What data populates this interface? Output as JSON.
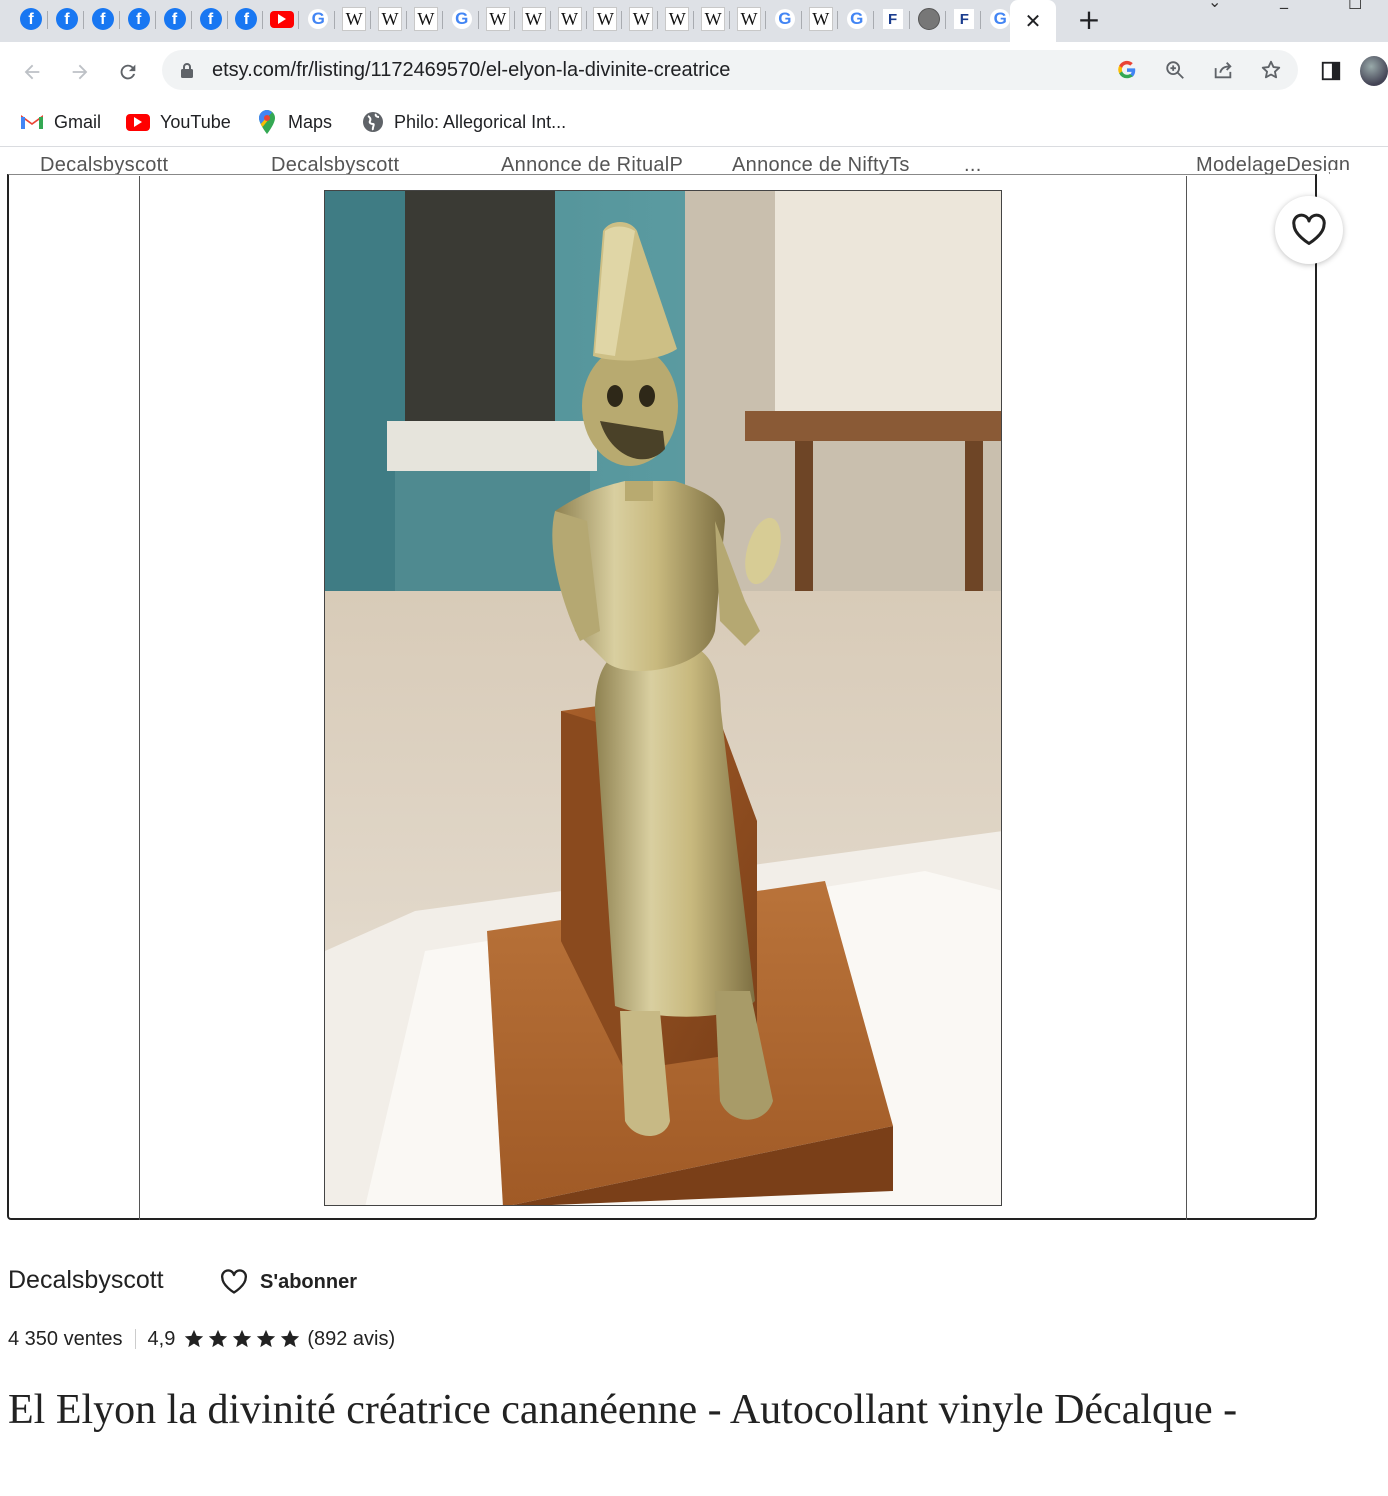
{
  "browser": {
    "tabs": [
      {
        "icon": "facebook-icon"
      },
      {
        "icon": "facebook-icon"
      },
      {
        "icon": "facebook-icon"
      },
      {
        "icon": "facebook-icon"
      },
      {
        "icon": "facebook-icon"
      },
      {
        "icon": "facebook-icon"
      },
      {
        "icon": "facebook-icon"
      },
      {
        "icon": "youtube-icon"
      },
      {
        "icon": "google-icon"
      },
      {
        "icon": "wikipedia-icon"
      },
      {
        "icon": "wikipedia-icon"
      },
      {
        "icon": "wikipedia-icon"
      },
      {
        "icon": "google-icon"
      },
      {
        "icon": "wikipedia-icon"
      },
      {
        "icon": "wikipedia-icon"
      },
      {
        "icon": "wikipedia-icon"
      },
      {
        "icon": "wikipedia-icon"
      },
      {
        "icon": "wikipedia-icon"
      },
      {
        "icon": "wikipedia-icon"
      },
      {
        "icon": "wikipedia-icon"
      },
      {
        "icon": "wikipedia-icon"
      },
      {
        "icon": "google-icon"
      },
      {
        "icon": "wikipedia-icon"
      },
      {
        "icon": "google-icon"
      },
      {
        "icon": "f-icon"
      },
      {
        "icon": "globe-icon"
      },
      {
        "icon": "f-icon"
      },
      {
        "icon": "google-icon"
      }
    ],
    "active_tab_close": "✕",
    "new_tab": "+",
    "address": "etsy.com/fr/listing/1172469570/el-elyon-la-divinite-creatrice",
    "bookmarks": [
      {
        "label": "Gmail",
        "icon": "gmail-icon"
      },
      {
        "label": "YouTube",
        "icon": "youtube-icon"
      },
      {
        "label": "Maps",
        "icon": "maps-icon"
      },
      {
        "label": "Philo: Allegorical Int...",
        "icon": "globe-icon"
      }
    ]
  },
  "page": {
    "shop_strip": [
      "Decalsbyscott",
      "Decalsbyscott",
      "Annonce de RitualP",
      "Annonce de NiftyTs",
      "...",
      "ModelageDesign"
    ],
    "shop_name": "Decalsbyscott",
    "follow_label": "S'abonner",
    "sales": "4 350 ventes",
    "rating": "4,9",
    "rating_stars": 5,
    "reviews": "(892 avis)",
    "title": "El Elyon la divinité créatrice cananéenne - Autocollant vinyle Décalque -"
  },
  "colors": {
    "accent": "#222222",
    "tab_bg": "#dee1e6",
    "omnibox_bg": "#f1f3f4",
    "facebook": "#1877f2",
    "youtube": "#ff0000"
  }
}
